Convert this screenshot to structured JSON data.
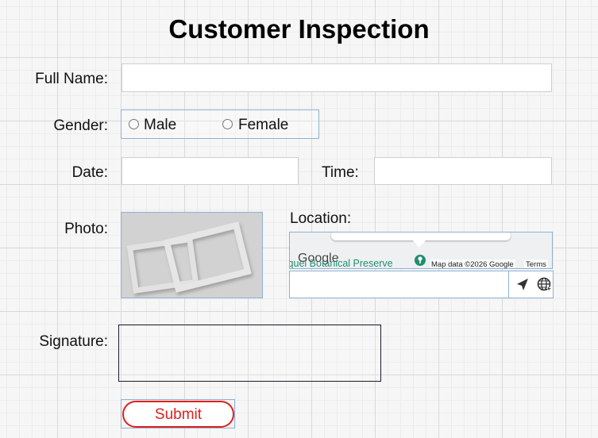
{
  "form": {
    "title": "Customer Inspection",
    "full_name": {
      "label": "Full Name:",
      "value": ""
    },
    "gender": {
      "label": "Gender:",
      "options": [
        "Male",
        "Female"
      ],
      "selected": null
    },
    "date": {
      "label": "Date:",
      "value": ""
    },
    "time": {
      "label": "Time:",
      "value": ""
    },
    "photo": {
      "label": "Photo:",
      "icon": "photo-placeholder-icon"
    },
    "location": {
      "label": "Location:",
      "value": "",
      "map": {
        "place_label": "liquel Botanical Preserve",
        "logo": "Google",
        "attribution": "Map data ©2026 Google",
        "terms": "Terms",
        "place_color": "#1e8e6e"
      },
      "buttons": [
        "navigation-arrow-icon",
        "globe-icon"
      ]
    },
    "signature": {
      "label": "Signature:"
    },
    "submit": {
      "label": "Submit",
      "color": "#e02020"
    }
  }
}
